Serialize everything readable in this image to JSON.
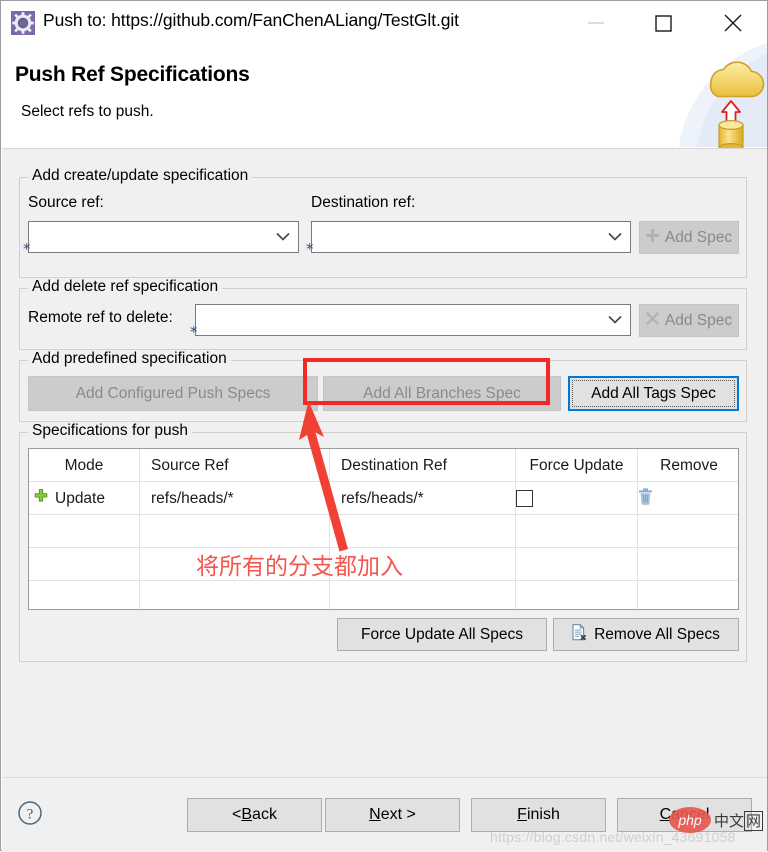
{
  "window": {
    "title": "Push to: https://github.com/FanChenALiang/TestGlt.git",
    "icon": "gear-icon",
    "controls": {
      "minimize": "minimize-icon",
      "maximize": "maximize-icon",
      "close": "close-icon"
    }
  },
  "header": {
    "title": "Push Ref Specifications",
    "subtitle": "Select refs to push.",
    "artwork": "cloud-upload-database-icon"
  },
  "create_update_group": {
    "title": "Add create/update specification",
    "source_label": "Source ref:",
    "destination_label": "Destination ref:",
    "source_value": "",
    "destination_value": "",
    "required_marker": "*",
    "add_spec_label": "Add Spec",
    "add_spec_icon": "plus-icon",
    "add_spec_enabled": false
  },
  "delete_group": {
    "title": "Add delete ref specification",
    "remote_label": "Remote ref to delete:",
    "remote_value": "",
    "required_marker": "*",
    "add_spec_label": "Add Spec",
    "add_spec_icon": "cross-icon",
    "add_spec_enabled": false
  },
  "predefined_group": {
    "title": "Add predefined specification",
    "configured_label": "Add Configured Push Specs",
    "branches_label": "Add All Branches Spec",
    "tags_label": "Add All Tags Spec"
  },
  "specs_group": {
    "title": "Specifications for push",
    "columns": [
      "Mode",
      "Source Ref",
      "Destination Ref",
      "Force Update",
      "Remove"
    ],
    "rows": [
      {
        "mode_icon": "plus-icon",
        "mode": "Update",
        "source_ref": "refs/heads/*",
        "destination_ref": "refs/heads/*",
        "force_update": false,
        "remove_icon": "trash-icon"
      }
    ],
    "force_update_all_label": "Force Update All Specs",
    "remove_all_label": "Remove All Specs",
    "remove_all_icon": "remove-document-icon"
  },
  "footer": {
    "help_icon": "help-icon",
    "back": {
      "prefix": "< ",
      "accel": "B",
      "rest": "ack"
    },
    "next": {
      "prefix": "",
      "accel": "N",
      "rest": "ext >"
    },
    "finish": {
      "prefix": "",
      "accel": "F",
      "rest": "inish"
    },
    "cancel": {
      "prefix": "",
      "accel": "C",
      "rest": "ancel"
    }
  },
  "annotations": {
    "highlight_target": "Add All Branches Spec",
    "note_text": "将所有的分支都加入",
    "arrow": "red-arrow-pointing-up"
  },
  "watermark": {
    "url": "https://blog.csdn.net/weixin_43691058",
    "logo_text": "php",
    "logo_cn_prefix": "中文",
    "logo_cn_boxed": "网"
  },
  "colors": {
    "accent": "#0078d7",
    "annotation_red": "#ee2b24",
    "note_red": "#f4554d",
    "panel": "#f0f0f0",
    "button": "#e1e1e1"
  }
}
